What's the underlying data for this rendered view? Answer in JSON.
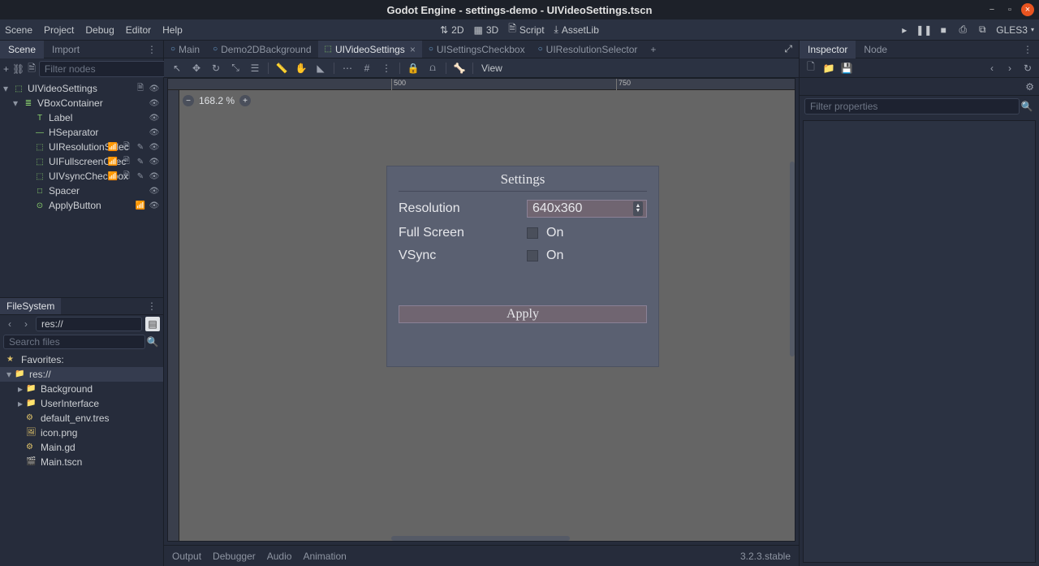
{
  "window_title": "Godot Engine - settings-demo - UIVideoSettings.tscn",
  "menu": [
    "Scene",
    "Project",
    "Debug",
    "Editor",
    "Help"
  ],
  "workspaces": [
    "2D",
    "3D",
    "Script",
    "AssetLib"
  ],
  "renderer": "GLES3",
  "left_docks": {
    "tabs": [
      "Scene",
      "Import"
    ],
    "active": 0
  },
  "scene_filter_placeholder": "Filter nodes",
  "scene_tree": [
    {
      "name": "UIVideoSettings",
      "indent": 0,
      "icon": "⬚",
      "chev": "▾",
      "right": [
        "sc",
        "eye"
      ]
    },
    {
      "name": "VBoxContainer",
      "indent": 1,
      "icon": "≣",
      "chev": "▾",
      "right": [
        "eye"
      ]
    },
    {
      "name": "Label",
      "indent": 2,
      "icon": "T",
      "chev": "",
      "right": [
        "eye"
      ]
    },
    {
      "name": "HSeparator",
      "indent": 2,
      "icon": "—",
      "chev": "",
      "right": [
        "eye"
      ]
    },
    {
      "name": "UIResolutionSelec",
      "indent": 2,
      "icon": "⬚",
      "chev": "",
      "right": [
        "sig",
        "sc",
        "ed",
        "eye"
      ]
    },
    {
      "name": "UIFullscreenChec",
      "indent": 2,
      "icon": "⬚",
      "chev": "",
      "right": [
        "sig",
        "sc",
        "ed",
        "eye"
      ]
    },
    {
      "name": "UIVsyncCheckbox",
      "indent": 2,
      "icon": "⬚",
      "chev": "",
      "right": [
        "sig",
        "sc",
        "ed",
        "eye"
      ]
    },
    {
      "name": "Spacer",
      "indent": 2,
      "icon": "□",
      "chev": "",
      "right": [
        "eye"
      ]
    },
    {
      "name": "ApplyButton",
      "indent": 2,
      "icon": "⊙",
      "chev": "",
      "right": [
        "sig",
        "eye"
      ]
    }
  ],
  "fs": {
    "label": "FileSystem",
    "path": "res://",
    "search_placeholder": "Search files",
    "favorites_label": "Favorites:",
    "tree": [
      {
        "name": "res://",
        "type": "root",
        "sel": true,
        "chev": "▾",
        "indent": 0
      },
      {
        "name": "Background",
        "type": "folder",
        "chev": "▸",
        "indent": 1
      },
      {
        "name": "UserInterface",
        "type": "folder",
        "chev": "▸",
        "indent": 1
      },
      {
        "name": "default_env.tres",
        "type": "res",
        "indent": 1
      },
      {
        "name": "icon.png",
        "type": "img",
        "indent": 1
      },
      {
        "name": "Main.gd",
        "type": "gd",
        "indent": 1
      },
      {
        "name": "Main.tscn",
        "type": "tscn",
        "indent": 1
      }
    ]
  },
  "open_scenes": [
    {
      "name": "Main",
      "active": false
    },
    {
      "name": "Demo2DBackground",
      "active": false
    },
    {
      "name": "UIVideoSettings",
      "active": true
    },
    {
      "name": "UISettingsCheckbox",
      "active": false
    },
    {
      "name": "UIResolutionSelector",
      "active": false
    }
  ],
  "view_label": "View",
  "ruler": {
    "500": "500",
    "750": "750"
  },
  "zoom": "168.2 %",
  "settings": {
    "title": "Settings",
    "rows": [
      {
        "label": "Resolution",
        "value": "640x360",
        "kind": "select"
      },
      {
        "label": "Full Screen",
        "value": "On",
        "kind": "check"
      },
      {
        "label": "VSync",
        "value": "On",
        "kind": "check"
      }
    ],
    "apply": "Apply"
  },
  "bottom": [
    "Output",
    "Debugger",
    "Audio",
    "Animation"
  ],
  "version": "3.2.3.stable",
  "right_docks": {
    "tabs": [
      "Inspector",
      "Node"
    ],
    "active": 0
  },
  "insp_filter_placeholder": "Filter properties"
}
